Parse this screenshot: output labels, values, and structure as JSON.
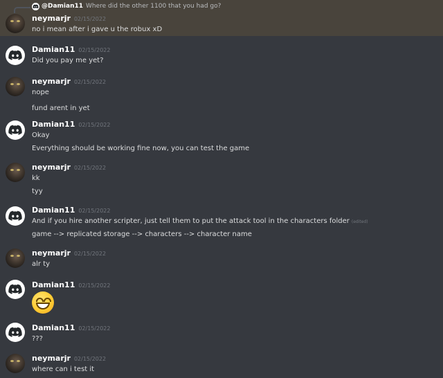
{
  "reply": {
    "user": "@Damian11",
    "text": "Where did the other 1100 that you had go?"
  },
  "messages": [
    {
      "user": "neymarjr",
      "avatar": "cat-avatar",
      "time": "02/15/2022",
      "lines": [
        "no i mean after i gave u the robux xD"
      ]
    },
    {
      "user": "Damian11",
      "avatar": "discord-avatar",
      "time": "02/15/2022",
      "lines": [
        "Did you pay me yet?"
      ]
    },
    {
      "user": "neymarjr",
      "avatar": "cat-avatar",
      "time": "02/15/2022",
      "lines": [
        "nope",
        "fund arent in yet"
      ]
    },
    {
      "user": "Damian11",
      "avatar": "discord-avatar",
      "time": "02/15/2022",
      "lines": [
        "Okay",
        "Everything should be working fine now, you can test the game"
      ]
    },
    {
      "user": "neymarjr",
      "avatar": "cat-avatar",
      "time": "02/15/2022",
      "lines": [
        "kk",
        "tyy"
      ]
    },
    {
      "user": "Damian11",
      "avatar": "discord-avatar",
      "time": "02/15/2022",
      "lines": [
        "And if you hire another scripter, just tell them to put the attack tool in the characters folder",
        "game --> replicated storage --> characters --> character name"
      ],
      "edited": "(edited)"
    },
    {
      "user": "neymarjr",
      "avatar": "cat-avatar",
      "time": "02/15/2022",
      "lines": [
        "alr ty"
      ]
    },
    {
      "user": "Damian11",
      "avatar": "discord-avatar",
      "time": "02/15/2022",
      "emoji": "grinning-face-emoji"
    },
    {
      "user": "Damian11",
      "avatar": "discord-avatar",
      "time": "02/15/2022",
      "lines": [
        "???"
      ]
    },
    {
      "user": "neymarjr",
      "avatar": "cat-avatar",
      "time": "02/15/2022",
      "lines": [
        "where can i test it"
      ]
    }
  ],
  "colors": {
    "background": "#36393f",
    "highlight": "#49443c",
    "username": "#ffffff",
    "timestamp": "#72767d",
    "text": "#dcddde"
  }
}
